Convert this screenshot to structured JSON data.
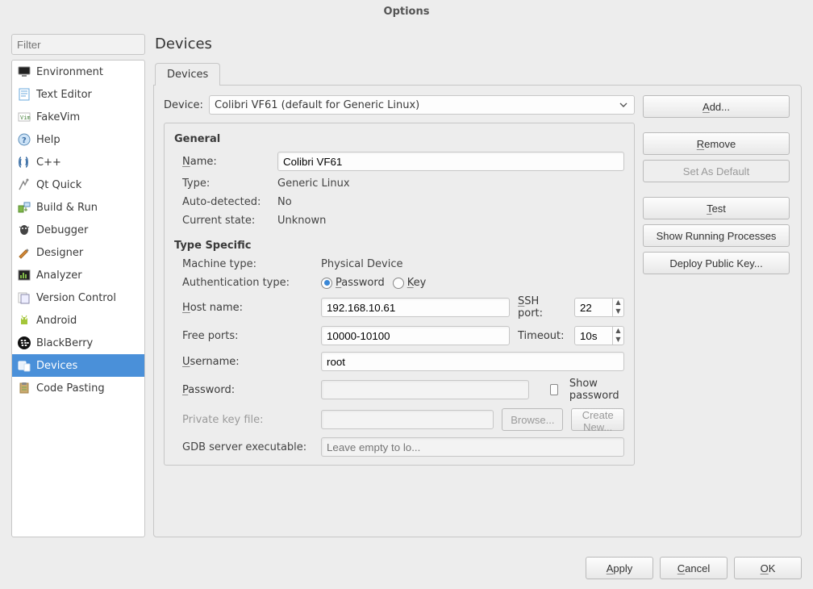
{
  "window": {
    "title": "Options"
  },
  "filter": {
    "placeholder": "Filter"
  },
  "categories": [
    {
      "label": "Environment",
      "icon": "monitor"
    },
    {
      "label": "Text Editor",
      "icon": "text-editor"
    },
    {
      "label": "FakeVim",
      "icon": "fakevim"
    },
    {
      "label": "Help",
      "icon": "help"
    },
    {
      "label": "C++",
      "icon": "cpp"
    },
    {
      "label": "Qt Quick",
      "icon": "qtquick"
    },
    {
      "label": "Build & Run",
      "icon": "buildrun"
    },
    {
      "label": "Debugger",
      "icon": "debugger"
    },
    {
      "label": "Designer",
      "icon": "designer"
    },
    {
      "label": "Analyzer",
      "icon": "analyzer"
    },
    {
      "label": "Version Control",
      "icon": "vcs"
    },
    {
      "label": "Android",
      "icon": "android"
    },
    {
      "label": "BlackBerry",
      "icon": "blackberry"
    },
    {
      "label": "Devices",
      "icon": "devices",
      "selected": true
    },
    {
      "label": "Code Pasting",
      "icon": "codepasting"
    }
  ],
  "main": {
    "title": "Devices",
    "tabs": [
      {
        "label": "Devices",
        "active": true
      }
    ],
    "device_label": "Device:",
    "device_selected": "Colibri VF61 (default for Generic Linux)",
    "right_buttons": {
      "add": "Add...",
      "remove": "Remove",
      "set_default": "Set As Default",
      "test": "Test",
      "show_proc": "Show Running Processes",
      "deploy_key": "Deploy Public Key..."
    },
    "general": {
      "title": "General",
      "name_label": "Name:",
      "name_value": "Colibri VF61",
      "type_label": "Type:",
      "type_value": "Generic Linux",
      "auto_label": "Auto-detected:",
      "auto_value": "No",
      "state_label": "Current state:",
      "state_value": "Unknown"
    },
    "typespec": {
      "title": "Type Specific",
      "machine_label": "Machine type:",
      "machine_value": "Physical Device",
      "auth_label": "Authentication type:",
      "auth_password": "Password",
      "auth_key": "Key",
      "host_label": "Host name:",
      "host_value": "192.168.10.61",
      "sshport_label": "SSH port:",
      "sshport_value": "22",
      "freeports_label": "Free ports:",
      "freeports_value": "10000-10100",
      "timeout_label": "Timeout:",
      "timeout_value": "10s",
      "user_label": "Username:",
      "user_value": "root",
      "password_label": "Password:",
      "password_value": "",
      "show_password": "Show password",
      "privkey_label": "Private key file:",
      "privkey_value": "",
      "browse": "Browse...",
      "create_new": "Create New...",
      "gdb_label": "GDB server executable:",
      "gdb_placeholder": "Leave empty to lo..."
    }
  },
  "footer": {
    "apply": "Apply",
    "cancel": "Cancel",
    "ok": "OK"
  }
}
